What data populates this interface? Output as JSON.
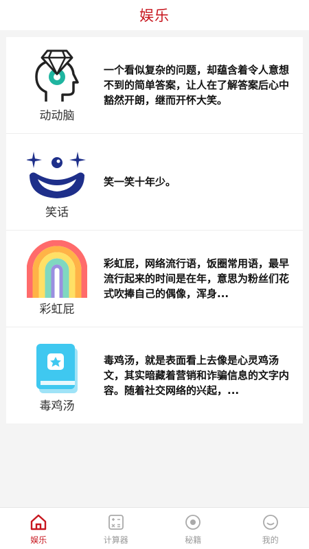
{
  "header": {
    "title": "娱乐"
  },
  "items": [
    {
      "label": "动动脑",
      "description": "一个看似复杂的问题，却蕴含着令人意想不到的简单答案，让人在了解答案后心中豁然开朗，继而开怀大笑。",
      "icon": "brain-diamond-icon"
    },
    {
      "label": "笑话",
      "description": "笑一笑十年少。",
      "icon": "clown-face-icon"
    },
    {
      "label": "彩虹屁",
      "description": "彩虹屁，网络流行语，饭圈常用语，最早流行起来的时间是在年，意思为粉丝们花式吹捧自己的偶像，浑身...",
      "icon": "rainbow-icon"
    },
    {
      "label": "毒鸡汤",
      "description": "毒鸡汤，就是表面看上去像是心灵鸡汤文，其实暗藏着营销和诈骗信息的文字内容。随着社交网络的兴起，...",
      "icon": "book-flower-icon"
    }
  ],
  "tabbar": {
    "tabs": [
      {
        "label": "娱乐",
        "icon": "home-icon",
        "active": true
      },
      {
        "label": "计算器",
        "icon": "calculator-icon",
        "active": false
      },
      {
        "label": "秘籍",
        "icon": "target-icon",
        "active": false
      },
      {
        "label": "我的",
        "icon": "smiley-icon",
        "active": false
      }
    ]
  },
  "colors": {
    "accent": "#c7161e",
    "inactive": "#9a9a9a",
    "teal": "#1fb5a0",
    "navy": "#1e2f8a",
    "book": "#3fc8f0"
  }
}
